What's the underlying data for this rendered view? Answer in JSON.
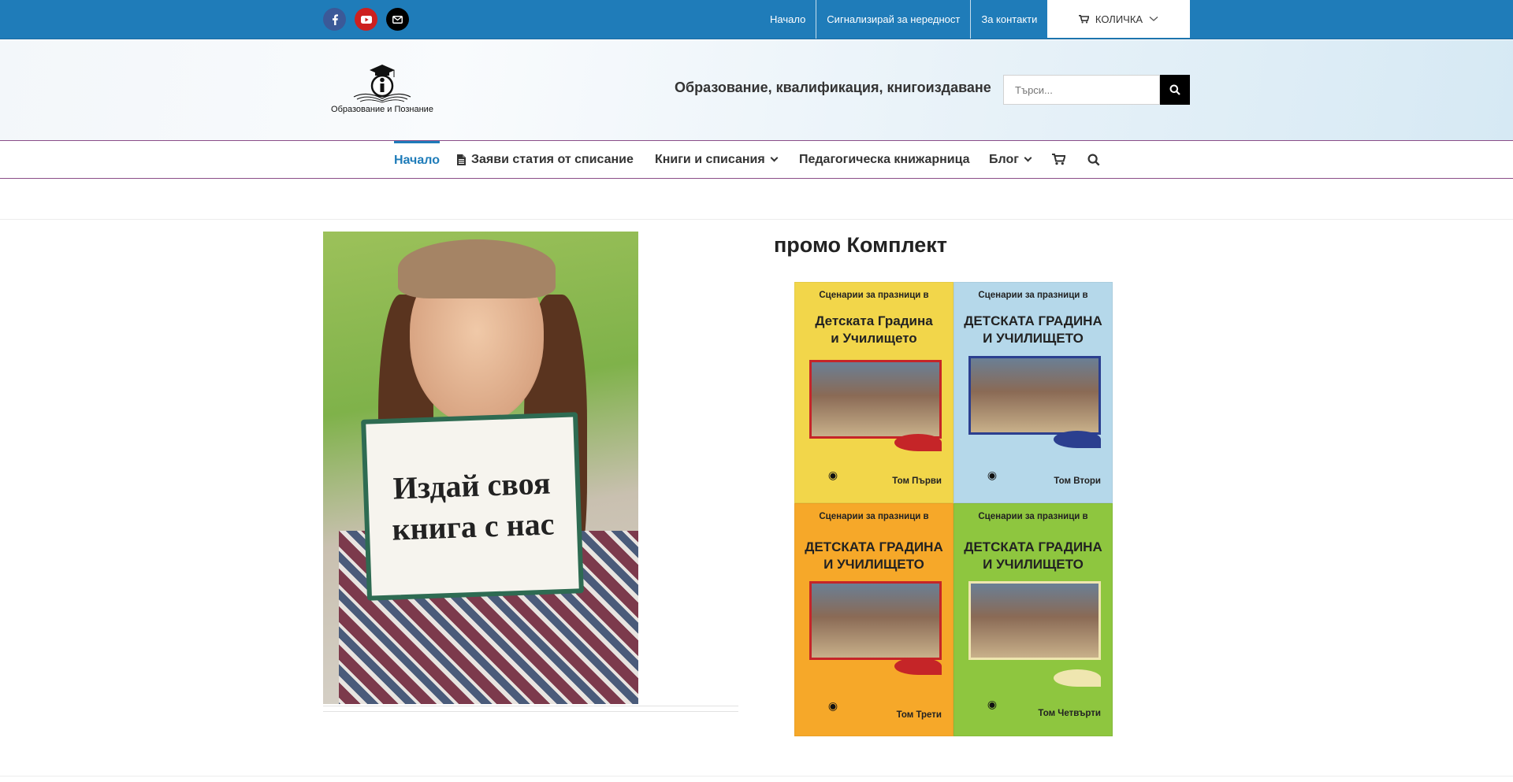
{
  "topbar": {
    "social": [
      "facebook-icon",
      "youtube-icon",
      "mail-icon"
    ],
    "links": [
      "Начало",
      "Сигнализирай за нередност",
      "За контакти"
    ],
    "cart_label": "КОЛИЧКА",
    "color": "#1f7cb9"
  },
  "header": {
    "logo_text": "Образование и Познание",
    "tagline": "Образование, квалификация, книгоиздаване",
    "search_placeholder": "Търси..."
  },
  "nav": {
    "home": "Начало",
    "submit_article": "Заяви статия от списание",
    "books": "Книги и списания",
    "bookstore": "Педагогическа книжарница",
    "blog": "Блог",
    "active_color": "#1f7cb9"
  },
  "promo": {
    "book_line1": "Издай своя",
    "book_line2": "книга с нас"
  },
  "product": {
    "title": "промо Комплект",
    "covers": [
      {
        "top": "Сценарии за празници в",
        "line1": "Детската Градина",
        "line2": "и Училището",
        "volume": "Том Първи",
        "bg": "#f2d64a",
        "frame": "#c52528",
        "ornament": "#c52528"
      },
      {
        "top": "Сценарии за празници в",
        "line1": "ДЕТСКАТА ГРАДИНА",
        "line2": "И УЧИЛИЩЕТО",
        "volume": "Том Втори",
        "bg": "#b5d8ea",
        "frame": "#2b3f8f",
        "ornament": "#2b3f8f"
      },
      {
        "top": "Сценарии за празници в",
        "line1": "ДЕТСКАТА ГРАДИНА",
        "line2": "И УЧИЛИЩЕТО",
        "volume": "Том Трети",
        "bg": "#f6a829",
        "frame": "#c52528",
        "ornament": "#c52528"
      },
      {
        "top": "Сценарии за празници в",
        "line1": "ДЕТСКАТА ГРАДИНА",
        "line2": "И УЧИЛИЩЕТО",
        "volume": "Том Четвърти",
        "bg": "#8ec63f",
        "frame": "#efe6b0",
        "ornament": "#efe6b0"
      }
    ]
  }
}
